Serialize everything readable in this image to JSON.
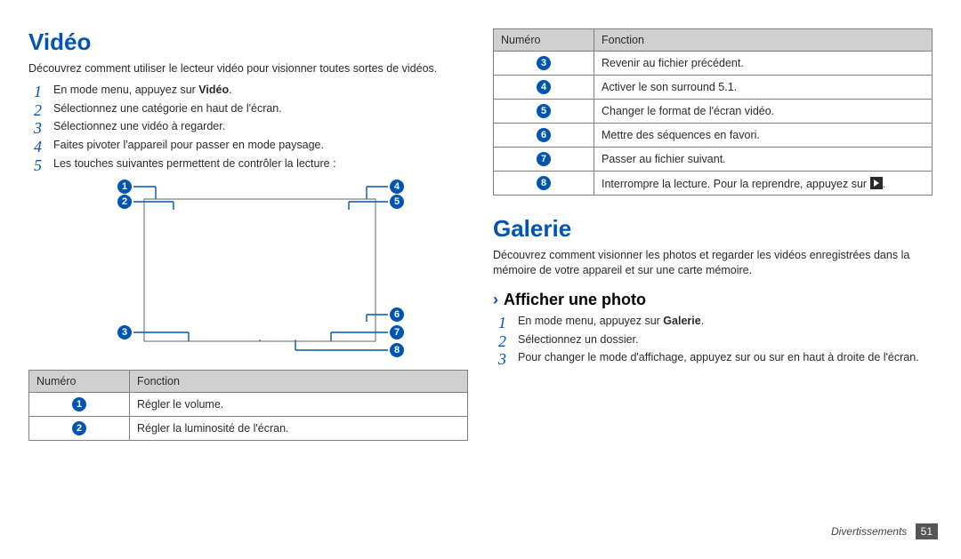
{
  "left": {
    "title": "Vidéo",
    "intro": "Découvrez comment utiliser le lecteur vidéo pour visionner toutes sortes de vidéos.",
    "steps": [
      {
        "pre": "En mode menu, appuyez sur ",
        "bold": "Vidéo",
        "post": "."
      },
      {
        "pre": "Sélectionnez une catégorie en haut de l'écran.",
        "bold": "",
        "post": ""
      },
      {
        "pre": "Sélectionnez une vidéo à regarder.",
        "bold": "",
        "post": ""
      },
      {
        "pre": "Faites pivoter l'appareil pour passer en mode paysage.",
        "bold": "",
        "post": ""
      },
      {
        "pre": "Les touches suivantes permettent de contrôler la lecture :",
        "bold": "",
        "post": ""
      }
    ],
    "table1_headers": [
      "Numéro",
      "Fonction"
    ],
    "table1_rows": [
      {
        "n": "1",
        "fn": "Régler le volume."
      },
      {
        "n": "2",
        "fn": "Régler la luminosité de l'écran."
      }
    ]
  },
  "right": {
    "table2_headers": [
      "Numéro",
      "Fonction"
    ],
    "table2_rows": [
      {
        "n": "3",
        "fn": "Revenir au fichier précédent."
      },
      {
        "n": "4",
        "fn": "Activer le son surround 5.1."
      },
      {
        "n": "5",
        "fn": "Changer le format de l'écran vidéo."
      },
      {
        "n": "6",
        "fn": "Mettre des séquences en favori."
      },
      {
        "n": "7",
        "fn": "Passer au fichier suivant."
      },
      {
        "n": "8",
        "fn_pre": "Interrompre la lecture. Pour la reprendre, appuyez sur ",
        "fn_post": "."
      }
    ],
    "title": "Galerie",
    "intro": "Découvrez comment visionner les photos et regarder les vidéos enregistrées dans la mémoire de votre appareil et sur une carte mémoire.",
    "sub_chevron": "›",
    "sub": "Afficher une photo",
    "steps": [
      {
        "pre": "En mode menu, appuyez sur ",
        "bold": "Galerie",
        "post": "."
      },
      {
        "pre": "Sélectionnez un dossier.",
        "bold": "",
        "post": ""
      },
      {
        "pre": "Pour changer le mode d'affichage, appuyez sur      ou sur      en haut à droite de l'écran.",
        "bold": "",
        "post": ""
      }
    ]
  },
  "footer": {
    "section": "Divertissements",
    "page": "51"
  },
  "diagram_labels": [
    "1",
    "2",
    "3",
    "4",
    "5",
    "6",
    "7",
    "8"
  ]
}
